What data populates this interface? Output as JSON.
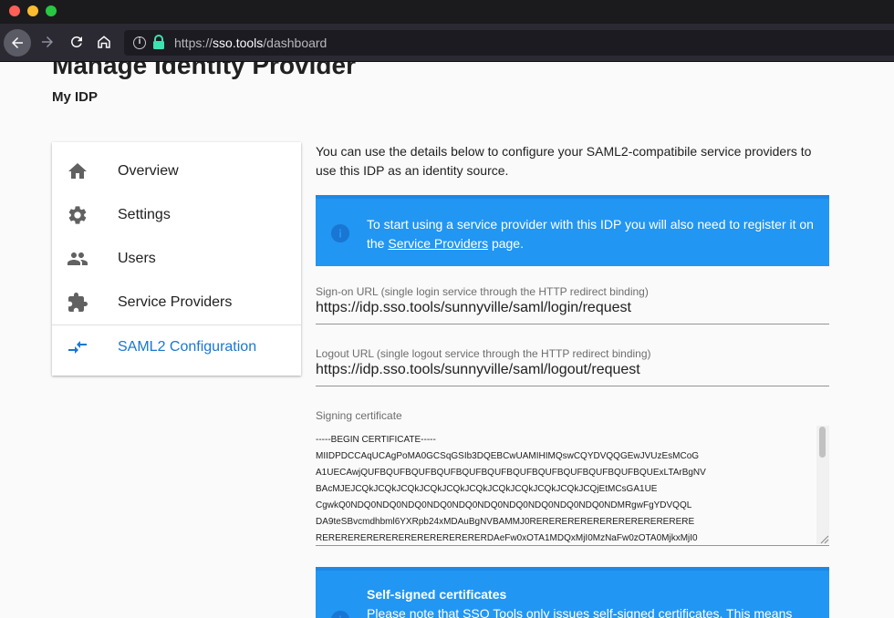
{
  "browser": {
    "url_scheme": "https://",
    "url_host": "sso.tools",
    "url_path": "/dashboard"
  },
  "page": {
    "title": "Manage Identity Provider",
    "subtitle": "My IDP"
  },
  "menu": {
    "items": [
      {
        "label": "Overview",
        "icon": "home-icon"
      },
      {
        "label": "Settings",
        "icon": "gear-icon"
      },
      {
        "label": "Users",
        "icon": "people-icon"
      },
      {
        "label": "Service Providers",
        "icon": "puzzle-icon"
      },
      {
        "label": "SAML2 Configuration",
        "icon": "compare-arrows-icon",
        "active": true
      }
    ]
  },
  "content": {
    "intro": "You can use the details below to configure your SAML2-compatibile service providers to use this IDP as an identity source.",
    "alert1": {
      "text_before": "To start using a service provider with this IDP you will also need to register it on the ",
      "link": "Service Providers",
      "text_after": " page."
    },
    "signon": {
      "label": "Sign-on URL (single login service through the HTTP redirect binding)",
      "value": "https://idp.sso.tools/sunnyville/saml/login/request"
    },
    "logout": {
      "label": "Logout URL (single logout service through the HTTP redirect binding)",
      "value": "https://idp.sso.tools/sunnyville/saml/logout/request"
    },
    "certificate": {
      "label": "Signing certificate",
      "lines": [
        "-----BEGIN CERTIFICATE-----",
        "MIIDPDCCAqUCAgPoMA0GCSqGSIb3DQEBCwUAMIHIMQswCQYDVQQGEwJVUzEsMCoG",
        "A1UECAwjQUFBQUFBQUFBQUFBQUFBQUFBQUFBQUFBQUFBQUFBQUFBQUExLTArBgNV",
        "BAcMJEJCQkJCQkJCQkJCQkJCQkJCQkJCQkJCQkJCQkJCQkJCQjEtMCsGA1UE",
        "CgwkQ0NDQ0NDQ0NDQ0NDQ0NDQ0NDQ0NDQ0NDQ0NDQ0NDQ0NDMRgwFgYDVQQL",
        "DA9teSBvcmdhbml6YXRpb24xMDAuBgNVBAMMJ0RERERERERERERERERERERERERE",
        "RERERERERERERERERERERERERERDAeFw0xOTA1MDQxMjI0MzNaFw0zOTA0MjkxMjI0"
      ]
    },
    "alert2": {
      "title": "Self-signed certificates",
      "body": "Please note that SSO Tools only issues self-signed certificates. This means"
    }
  }
}
